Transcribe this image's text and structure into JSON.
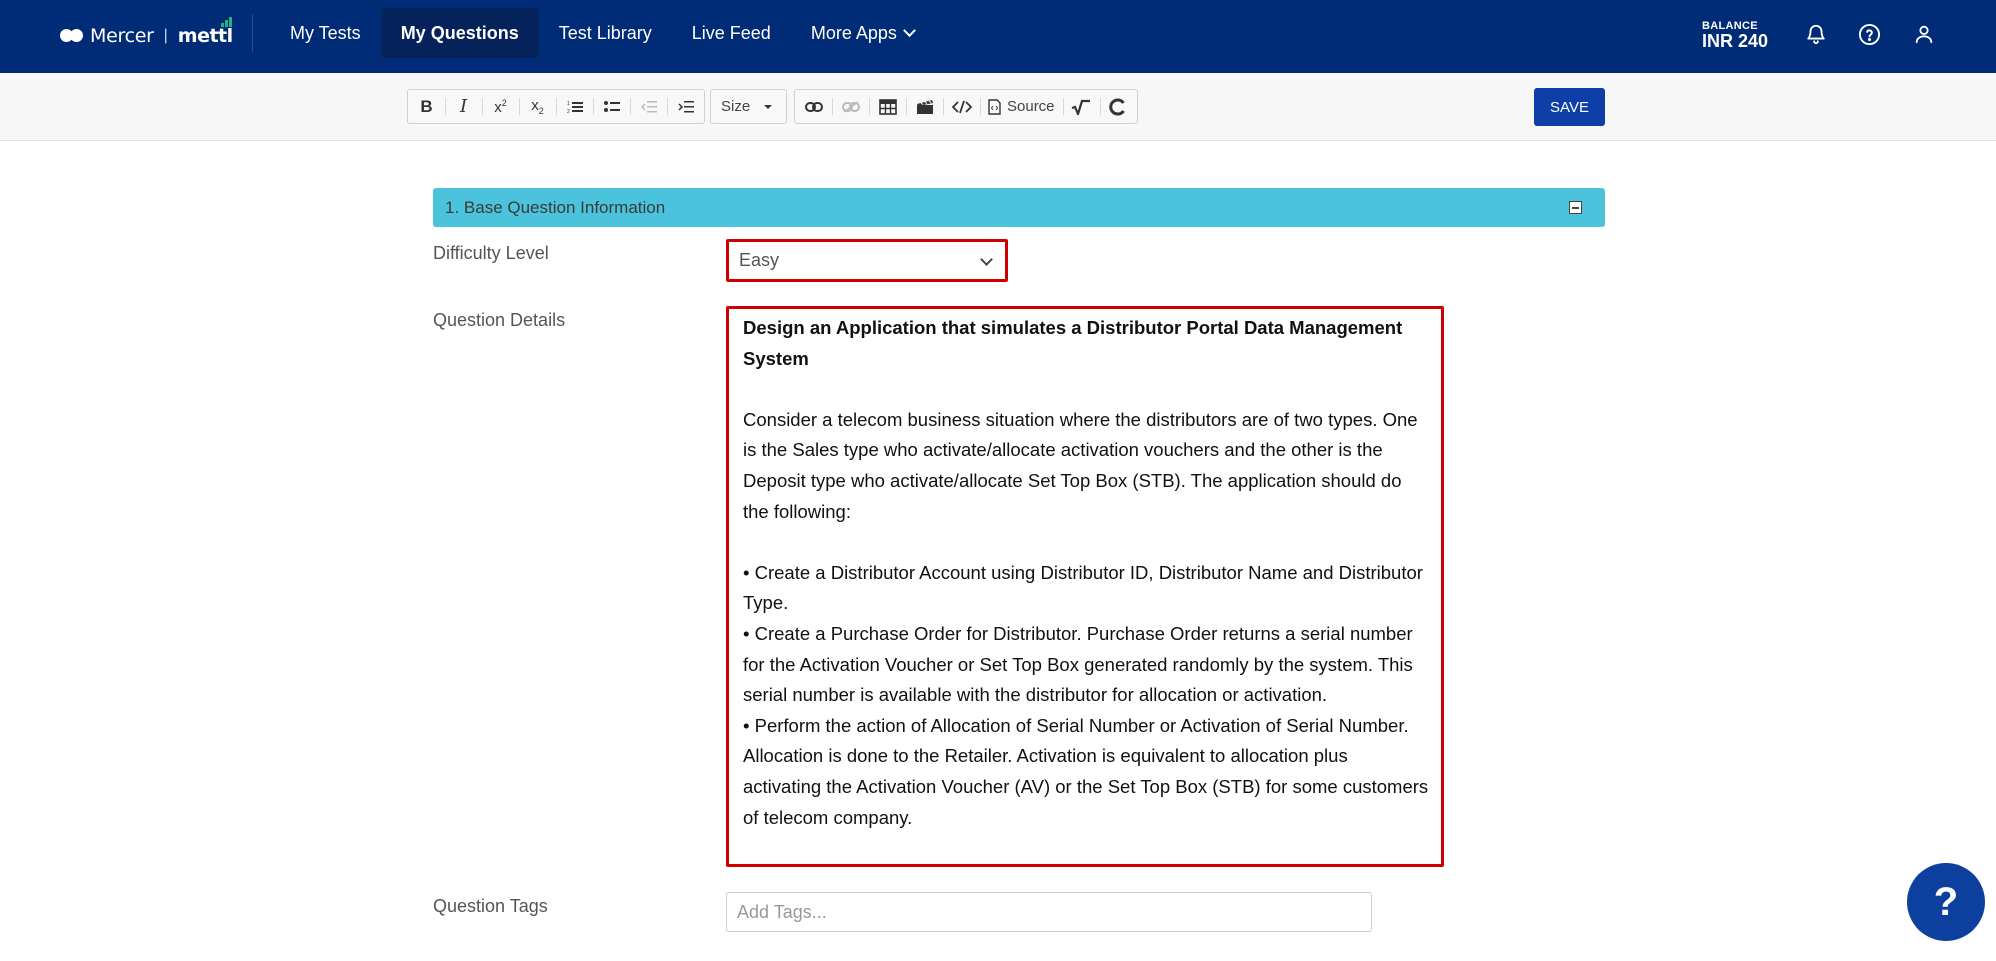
{
  "header": {
    "brand": "Mercer",
    "brand_separator": "|",
    "product": "mettl",
    "nav": [
      {
        "label": "My Tests",
        "active": false
      },
      {
        "label": "My Questions",
        "active": true
      },
      {
        "label": "Test Library",
        "active": false
      },
      {
        "label": "Live Feed",
        "active": false
      },
      {
        "label": "More Apps",
        "active": false
      }
    ],
    "balance_label": "BALANCE",
    "balance_value": "INR 240",
    "icons": [
      "bell-icon",
      "help-circle-icon",
      "user-icon"
    ]
  },
  "toolbar": {
    "size_label": "Size",
    "source_label": "Source",
    "save_label": "SAVE"
  },
  "section": {
    "title": "1. Base Question Information"
  },
  "form": {
    "difficulty_label": "Difficulty Level",
    "difficulty_value": "Easy",
    "details_label": "Question Details",
    "details_title": "Design an Application that simulates a Distributor Portal Data Management System",
    "details_para1": "Consider a telecom business situation where the distributors are of two types. One is the Sales type who activate/allocate activation vouchers and the other is the Deposit type who activate/allocate Set Top Box (STB). The application should do the following:",
    "bullets": [
      "• Create a Distributor Account using Distributor ID, Distributor Name and Distributor Type.",
      "• Create a Purchase Order for Distributor. Purchase Order returns a serial number for the Activation Voucher or Set Top Box generated randomly by the system. This serial number is available with the distributor for allocation or activation.",
      "• Perform the action of Allocation of Serial Number or Activation of Serial Number. Allocation is done to the Retailer. Activation is equivalent to allocation plus activating the Activation Voucher (AV) or the Set Top Box (STB) for some customers of telecom company."
    ],
    "tags_label": "Question Tags",
    "tags_placeholder": "Add Tags..."
  },
  "help_fab": "?",
  "colors": {
    "header_bg": "#002c77",
    "section_bg": "#4bc3dc",
    "save_bg": "#0e3fa8",
    "highlight_border": "#cc0000"
  }
}
